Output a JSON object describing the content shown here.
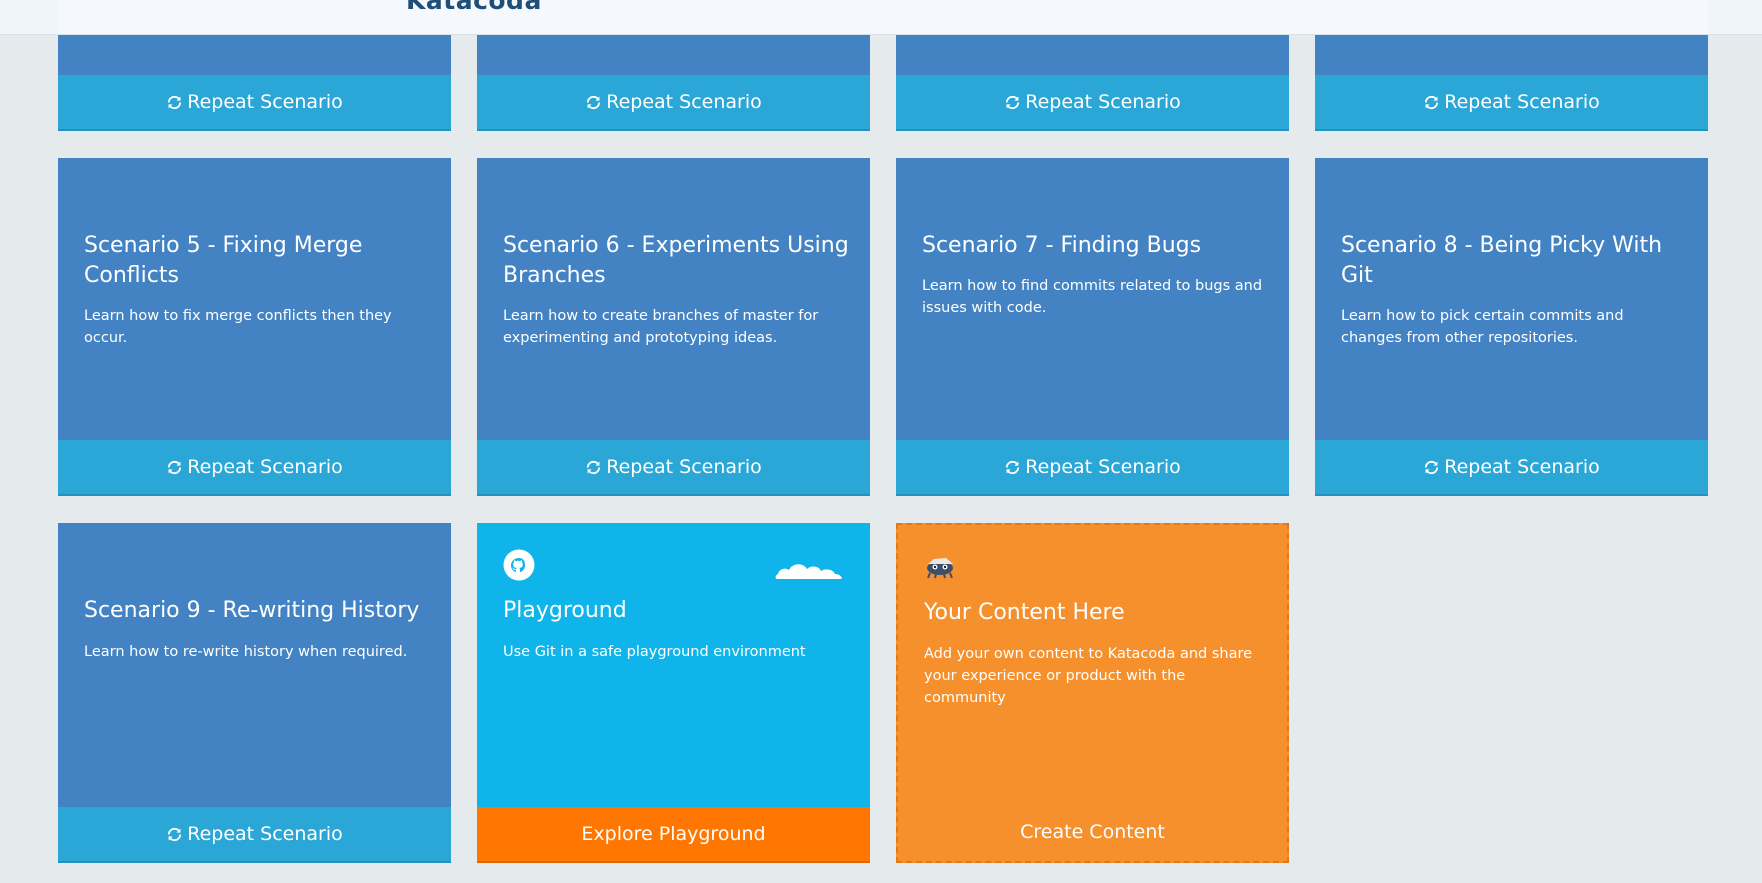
{
  "header": {
    "logo": "Katacoda"
  },
  "repeat_label": "Repeat Scenario",
  "scenarios": [
    {
      "title": "Scenario 5 - Fixing Merge Conflicts",
      "description": "Learn how to fix merge conflicts then they occur."
    },
    {
      "title": "Scenario 6 - Experiments Using Branches",
      "description": "Learn how to create branches of master for experimenting and prototyping ideas."
    },
    {
      "title": "Scenario 7 - Finding Bugs",
      "description": "Learn how to find commits related to bugs and issues with code."
    },
    {
      "title": "Scenario 8 - Being Picky With Git",
      "description": "Learn how to pick certain commits and changes from other repositories."
    },
    {
      "title": "Scenario 9 - Re-writing History",
      "description": "Learn how to re-write history when required."
    }
  ],
  "playground": {
    "title": "Playground",
    "description": "Use Git in a safe playground environment",
    "button": "Explore Playground"
  },
  "content_card": {
    "title": "Your Content Here",
    "description": "Add your own content to Katacoda and share your experience or product with the community",
    "button": "Create Content"
  },
  "colors": {
    "card_blue": "#4383c4",
    "repeat_footer": "#2aa7d6",
    "playground_bg": "#0fb5ea",
    "playground_button": "#ff7700",
    "content_card_bg": "#f5902d",
    "page_bg": "#e5eaed"
  }
}
